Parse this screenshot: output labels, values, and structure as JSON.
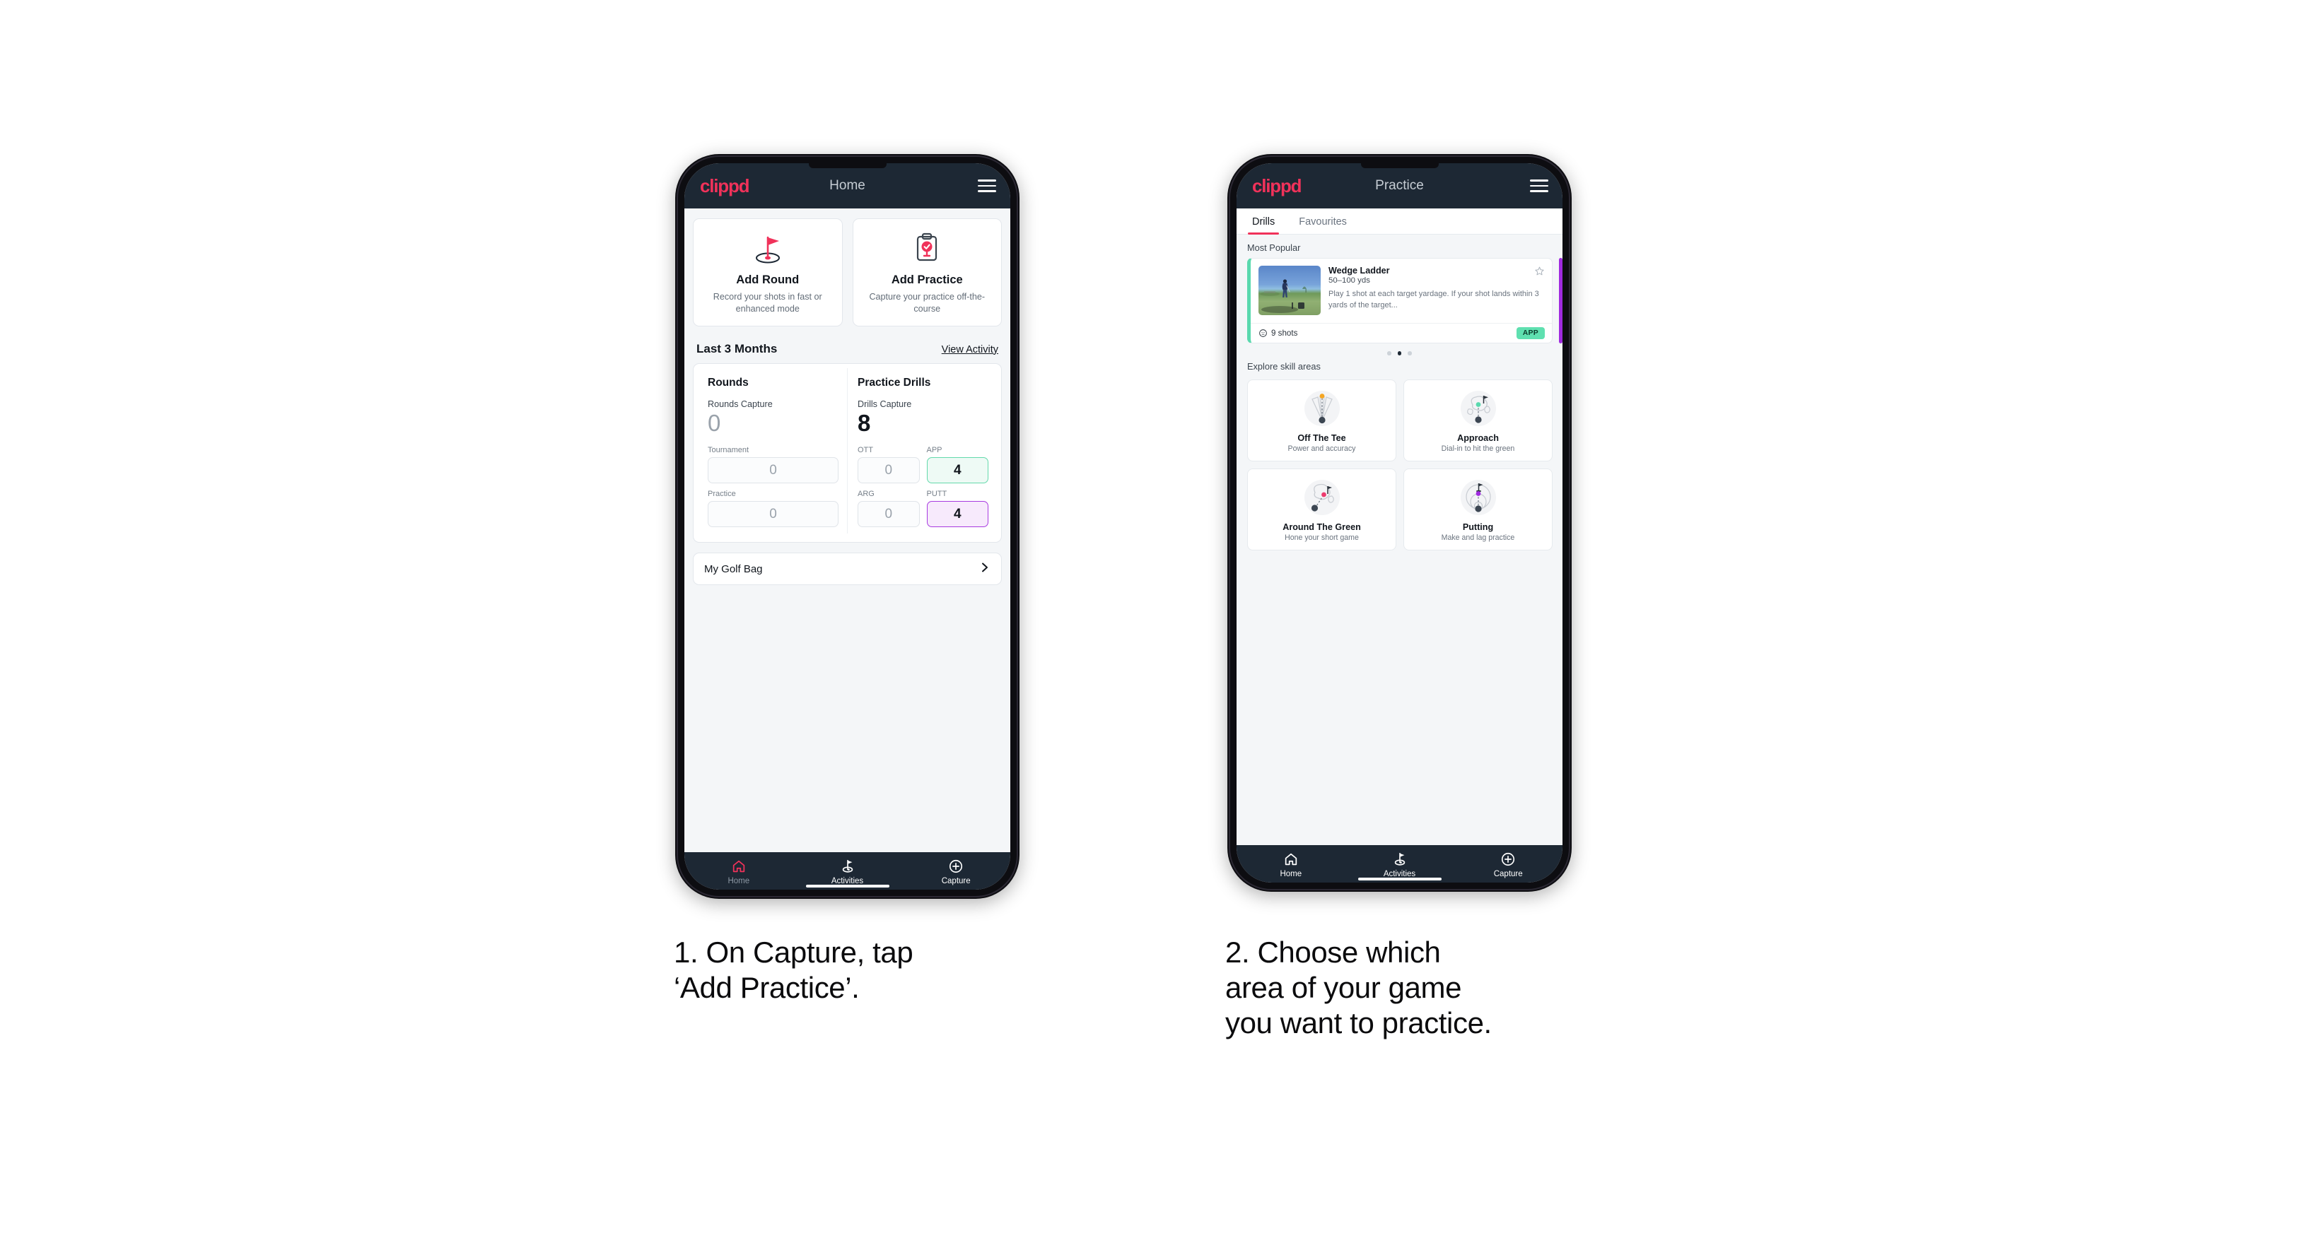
{
  "phones": [
    {
      "id": "phone-home",
      "appbar": {
        "logo": "clippd",
        "title": "Home",
        "menu_icon": "hamburger-menu-icon"
      },
      "actions": [
        {
          "icon": "golf-flag-hole-icon",
          "title": "Add Round",
          "subtitle": "Record your shots in fast or enhanced mode"
        },
        {
          "icon": "clipboard-check-icon",
          "title": "Add Practice",
          "subtitle": "Capture your practice off-the-course"
        }
      ],
      "section": {
        "title": "Last 3 Months",
        "link": "View Activity"
      },
      "stats": {
        "rounds": {
          "heading": "Rounds",
          "capture_label": "Rounds Capture",
          "capture_value": "0",
          "fields": [
            {
              "label": "Tournament",
              "value": "0",
              "state": "empty"
            },
            {
              "label": "Practice",
              "value": "0",
              "state": "empty"
            }
          ]
        },
        "drills": {
          "heading": "Practice Drills",
          "capture_label": "Drills Capture",
          "capture_value": "8",
          "fields": [
            {
              "label": "OTT",
              "value": "0",
              "state": "empty"
            },
            {
              "label": "APP",
              "value": "4",
              "state": "app"
            },
            {
              "label": "ARG",
              "value": "0",
              "state": "empty"
            },
            {
              "label": "PUTT",
              "value": "4",
              "state": "putt"
            }
          ]
        }
      },
      "bag": {
        "label": "My Golf Bag",
        "icon": "chevron-right-icon"
      },
      "nav": [
        {
          "icon": "home-icon",
          "label": "Home",
          "active": true
        },
        {
          "icon": "golf-flag-icon",
          "label": "Activities",
          "active": false
        },
        {
          "icon": "plus-circle-icon",
          "label": "Capture",
          "active": false
        }
      ]
    },
    {
      "id": "phone-practice",
      "appbar": {
        "logo": "clippd",
        "title": "Practice",
        "menu_icon": "hamburger-menu-icon"
      },
      "tabs": [
        {
          "label": "Drills",
          "active": true
        },
        {
          "label": "Favourites",
          "active": false
        }
      ],
      "most_popular_label": "Most Popular",
      "drill": {
        "title": "Wedge Ladder",
        "yardage": "50–100 yds",
        "description": "Play 1 shot at each target yardage. If your shot lands within 3 yards of the target...",
        "shots": "9 shots",
        "shots_icon": "clock-icon",
        "badge": "APP",
        "star_icon": "star-outline-icon",
        "thumbnail": "golfer-wedge-shot-photo",
        "accent_color": "#5ad9ae",
        "peek_color": "#a02ae0"
      },
      "carousel_dots": {
        "count": 3,
        "active_index": 1
      },
      "explore_label": "Explore skill areas",
      "skills": [
        {
          "icon": "tee-dispersion-icon",
          "title": "Off The Tee",
          "subtitle": "Power and accuracy",
          "dot_color": "#f5a623"
        },
        {
          "icon": "green-approach-icon",
          "title": "Approach",
          "subtitle": "Dial-in to hit the green",
          "dot_color": "#5ad9ae"
        },
        {
          "icon": "chip-around-green-icon",
          "title": "Around The Green",
          "subtitle": "Hone your short game",
          "dot_color": "#ed3b6e"
        },
        {
          "icon": "putting-rings-icon",
          "title": "Putting",
          "subtitle": "Make and lag practice",
          "dot_color": "#a02ae0"
        }
      ],
      "nav": [
        {
          "icon": "home-icon",
          "label": "Home",
          "active": false
        },
        {
          "icon": "golf-flag-icon",
          "label": "Activities",
          "active": false
        },
        {
          "icon": "plus-circle-icon",
          "label": "Capture",
          "active": false
        }
      ]
    }
  ],
  "captions": [
    {
      "text": "1. On Capture, tap\n‘Add Practice’."
    },
    {
      "text": "2. Choose which\narea of your game\nyou want to practice."
    }
  ],
  "colors": {
    "brand_pink": "#f0325a",
    "appbar": "#1d2834",
    "page_bg": "#f4f6f8",
    "app_green": "#5fe0b0",
    "putt_purple": "#a02ae0"
  }
}
